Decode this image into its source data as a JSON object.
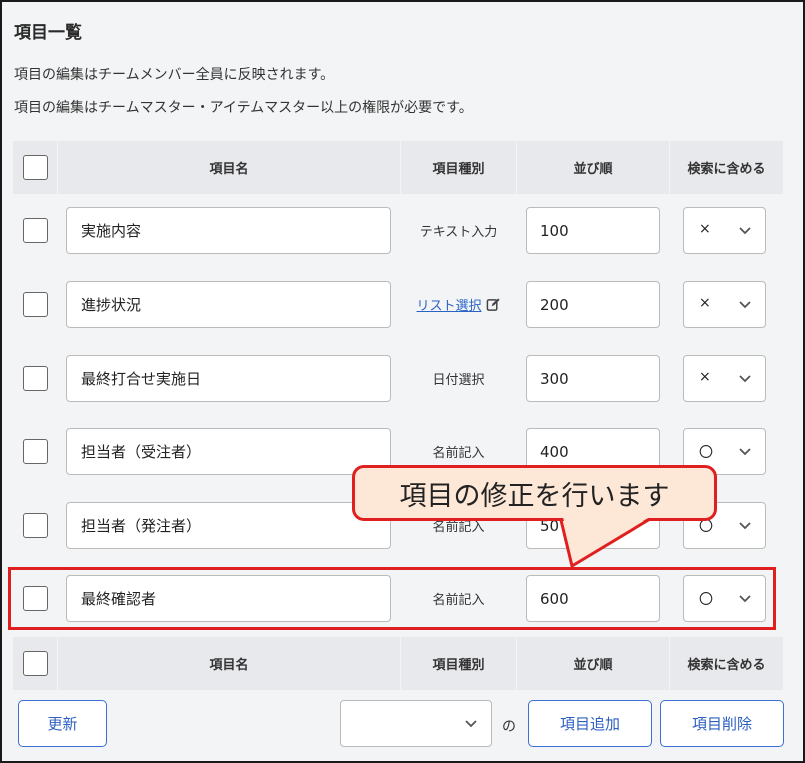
{
  "section": {
    "title": "項目一覧",
    "description1": "項目の編集はチームメンバー全員に反映されます。",
    "description2": "項目の編集はチームマスター・アイテムマスター以上の権限が必要です。"
  },
  "table": {
    "headers": {
      "name": "項目名",
      "type": "項目種別",
      "order": "並び順",
      "search": "検索に含める"
    },
    "rows": [
      {
        "name": "実施内容",
        "type": "テキスト入力",
        "order": "100",
        "search": "×"
      },
      {
        "name": "進捗状況",
        "type": "リスト選択",
        "order": "200",
        "search": "×"
      },
      {
        "name": "最終打合せ実施日",
        "type": "日付選択",
        "order": "300",
        "search": "×"
      },
      {
        "name": "担当者（受注者）",
        "type": "名前記入",
        "order": "400",
        "search": "〇"
      },
      {
        "name": "担当者（発注者）",
        "type": "名前記入",
        "order": "50",
        "search": "〇"
      },
      {
        "name": "最終確認者",
        "type": "名前記入",
        "order": "600",
        "search": "〇"
      }
    ]
  },
  "callout": {
    "text": "項目の修正を行います"
  },
  "footer": {
    "update_label": "更新",
    "no_label": "の",
    "add_label": "項目追加",
    "delete_label": "項目削除",
    "select_value": ""
  },
  "colors": {
    "highlight": "#e02020",
    "callout_bg": "#fde8d8",
    "link": "#2b63c5",
    "button": "#3b6fd0"
  },
  "icons": {
    "edit": "edit-icon",
    "chevron": "chevron-down-icon"
  }
}
